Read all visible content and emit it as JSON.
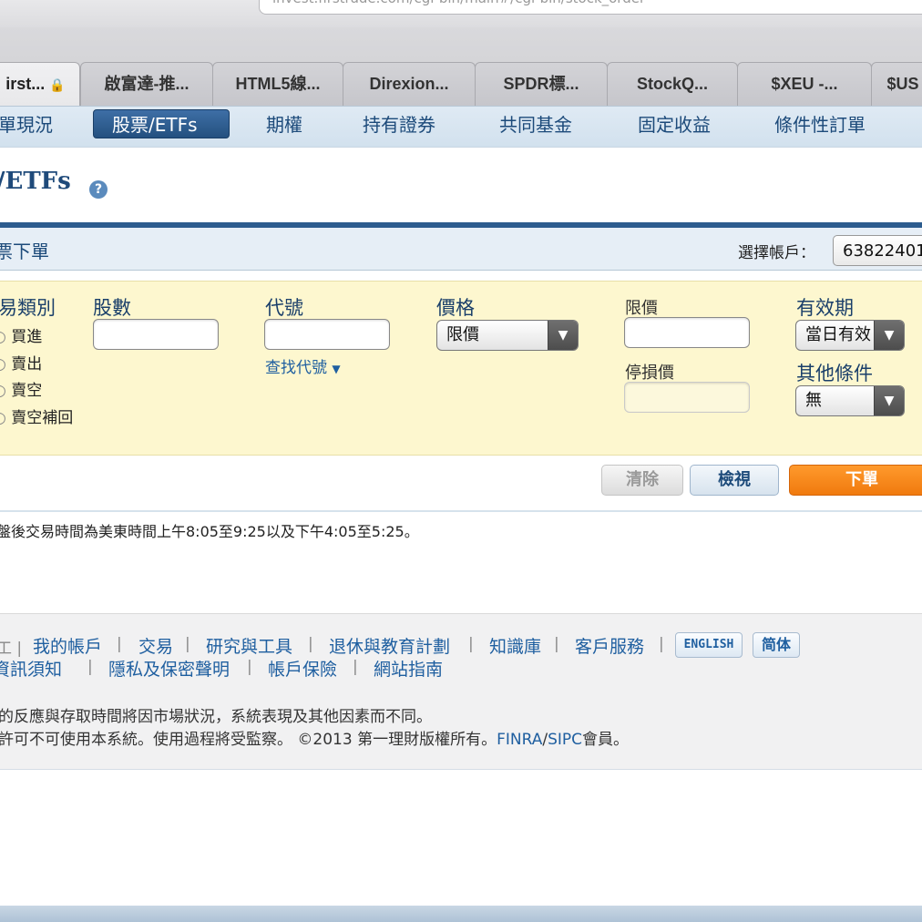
{
  "browser": {
    "url": "invest.firstrade.com/cgi-bin/main#/cgi-bin/stock_order",
    "tabs": [
      {
        "label": "irst...",
        "secure": true
      },
      {
        "label": "啟富達-推..."
      },
      {
        "label": "HTML5線..."
      },
      {
        "label": "Direxion..."
      },
      {
        "label": "SPDR標..."
      },
      {
        "label": "StockQ..."
      },
      {
        "label": "$XEU -..."
      },
      {
        "label": "$US"
      }
    ]
  },
  "subnav": [
    "單現況",
    "股票/ETFs",
    "期權",
    "持有證券",
    "共同基金",
    "固定收益",
    "條件性訂單"
  ],
  "page": {
    "title": "/ETFs",
    "section_title": "票下單",
    "account_label": "選擇帳戶：",
    "account_value": "63822401"
  },
  "form": {
    "trade_type_label": "易類別",
    "trade_types": [
      "買進",
      "賣出",
      "賣空",
      "賣空補回"
    ],
    "shares_label": "股數",
    "symbol_label": "代號",
    "symbol_lookup": "查找代號",
    "price_label": "價格",
    "price_type": "限價",
    "limit_price_label": "限價",
    "stop_price_label": "停損價",
    "duration_label": "有效期",
    "duration_value": "當日有效",
    "other_label": "其他條件",
    "other_value": "無"
  },
  "buttons": {
    "clear": "清除",
    "review": "檢視",
    "submit": "下單"
  },
  "notice": "盤後交易時間為美東時間上午8:05至9:25以及下午4:05至5:25。",
  "footer": {
    "row1": [
      "我的帳戶",
      "交易",
      "研究與工具",
      "退休與教育計劃",
      "知識庫",
      "客戶服務"
    ],
    "lang_en": "ENGLISH",
    "lang_cn": "简体",
    "row2": [
      "資訊須知",
      "隱私及保密聲明",
      "帳戶保險",
      "網站指南"
    ],
    "line1": "的反應與存取時間將因市場狀況，系統表現及其他因素而不同。",
    "line2_pre": "許可不可使用本系統。使用過程將受監察。 ©2013 第一理財版權所有。",
    "finra": "FINRA",
    "sipc": "SIPC",
    "line2_post": "會員。"
  }
}
